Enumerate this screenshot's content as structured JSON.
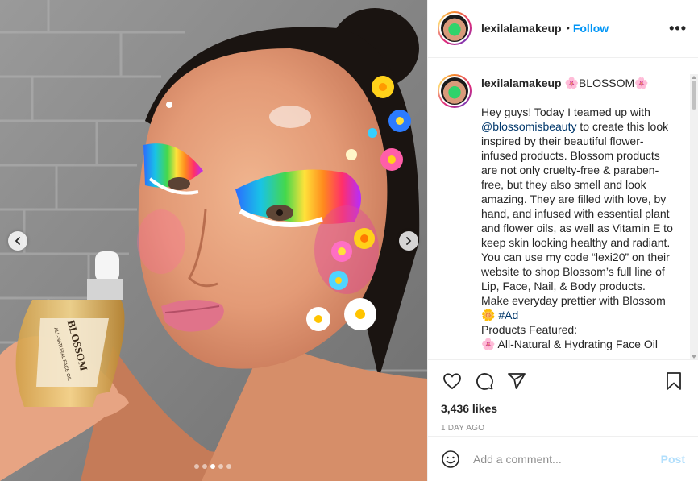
{
  "post": {
    "username": "lexilalamakeup",
    "separator": "•",
    "follow_label": "Follow",
    "more_icon": "more-options-icon",
    "more_label": "•••"
  },
  "caption": {
    "username": "lexilalamakeup",
    "title": "🌸BLOSSOM🌸",
    "text_before_mention": "Hey guys! Today I teamed up with ",
    "mention": "@blossomisbeauty",
    "text_after_mention": " to create this look inspired by their beautiful flower-infused products. Blossom products are not only cruelty-free & paraben-free, but they also smell and look amazing. They are filled with love, by hand, and infused with essential plant and flower oils, as well as Vitamin E to keep skin looking healthy and radiant. You can use my code “lexi20” on their website to shop Blossom’s full line of Lip, Face, Nail, & Body products. Make everyday prettier with Blossom\n🌼 ",
    "hashtag": "#Ad",
    "products_heading": "\nProducts Featured:",
    "product_first": "\n🌸 All-Natural & Hydrating Face Oil"
  },
  "media": {
    "prev_icon": "chevron-left-icon",
    "next_icon": "chevron-right-icon",
    "slide_count": 5,
    "active_slide": 3,
    "product_label": "BLOSSOM",
    "product_sub": "ALL-NATURAL FACE OIL"
  },
  "actions": {
    "like_icon": "heart-icon",
    "comment_icon": "comment-icon",
    "share_icon": "share-icon",
    "save_icon": "bookmark-icon",
    "likes": "3,436 likes",
    "timestamp": "1 DAY AGO"
  },
  "comment": {
    "emoji_icon": "emoji-icon",
    "placeholder": "Add a comment...",
    "post_label": "Post"
  },
  "colors": {
    "link": "#0095f6",
    "mention": "#00376b",
    "post_disabled": "#b2dffc",
    "muted": "#8e8e8e"
  }
}
